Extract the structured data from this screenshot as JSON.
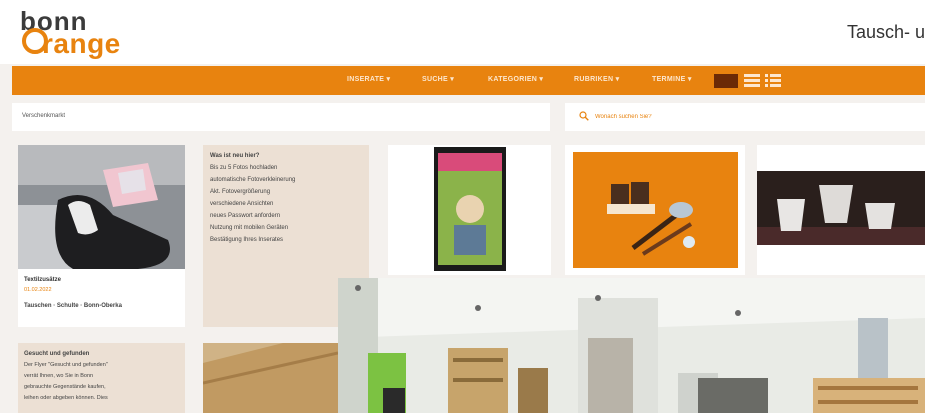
{
  "header": {
    "logo_top": "bonn",
    "logo_bottom": "range",
    "tagline": "Tausch- u"
  },
  "nav": {
    "items": [
      "INSERATE ▾",
      "SUCHE ▾",
      "KATEGORIEN ▾",
      "RUBRIKEN ▾",
      "TERMINE ▾"
    ]
  },
  "breadcrumb": "Verschenkmarkt",
  "search": {
    "placeholder": "Wonach suchen Sie?"
  },
  "cards": {
    "gloves": {
      "title": "Textilzusätze",
      "date": "01.02.2022",
      "tags": "Tauschen · Schulte · Bonn-Oberka"
    },
    "info": {
      "title": "Was ist neu hier?",
      "lines": [
        "Bis zu 5 Fotos hochladen",
        "automatische Fotoverkleinerung",
        "Akt. Fotovergrößerung",
        "verschiedene Ansichten",
        "neues Passwort anfordern",
        "Nutzung mit mobilen Geräten",
        "Bestätigung Ihres Inserates"
      ]
    },
    "found": {
      "title": "Gesucht und gefunden",
      "lines": [
        "Der Flyer \"Gesucht und gefunden\"",
        "verrät Ihnen, wo Sie in Bonn",
        "gebrauchte Gegenstände kaufen,",
        "leihen oder abgeben können. Dies"
      ]
    }
  },
  "colors": {
    "accent": "#e8830f",
    "nav_text": "#fde7cf",
    "beige": "#ece0d4"
  }
}
